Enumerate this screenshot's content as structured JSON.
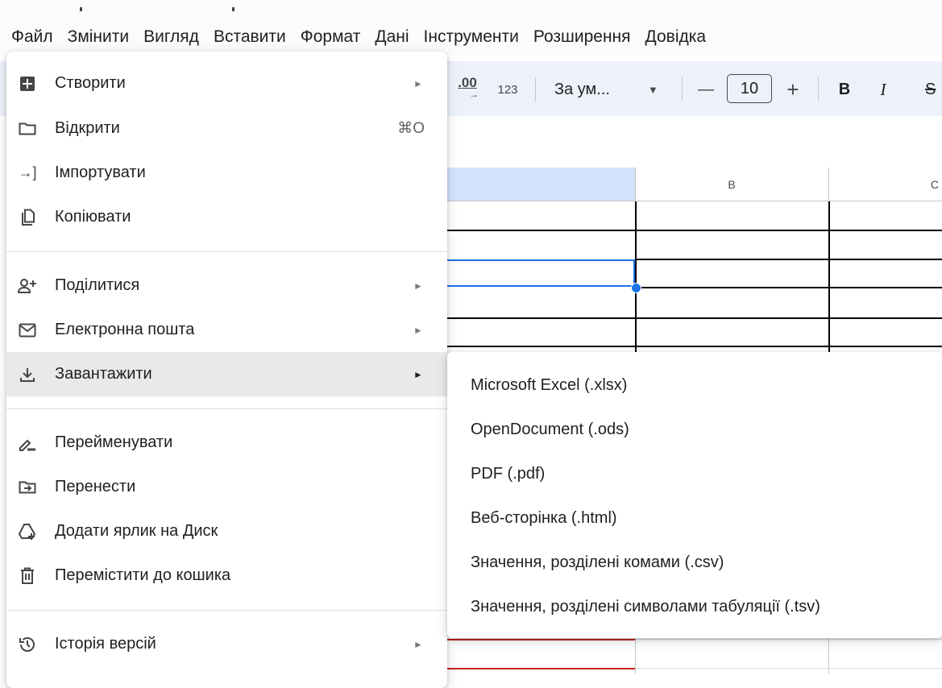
{
  "menubar": {
    "items": [
      "Файл",
      "Змінити",
      "Вигляд",
      "Вставити",
      "Формат",
      "Дані",
      "Інструменти",
      "Розширення",
      "Довідка"
    ]
  },
  "toolbar": {
    "decimal_label": ".00",
    "number_format_label": "123",
    "font_name": "За ум...",
    "font_size": "10",
    "minus": "—",
    "plus": "+",
    "bold": "B",
    "italic": "I",
    "strike": "S"
  },
  "grid": {
    "columns": [
      "B",
      "C"
    ]
  },
  "file_menu": {
    "groups": [
      [
        {
          "label": "Створити",
          "icon": "create-icon",
          "submenu": true
        },
        {
          "label": "Відкрити",
          "icon": "folder-icon",
          "shortcut": "⌘O"
        },
        {
          "label": "Імпортувати",
          "icon": "import-icon"
        },
        {
          "label": "Копіювати",
          "icon": "copy-icon"
        }
      ],
      [
        {
          "label": "Поділитися",
          "icon": "share-person-icon",
          "submenu": true
        },
        {
          "label": "Електронна пошта",
          "icon": "mail-icon",
          "submenu": true
        },
        {
          "label": "Завантажити",
          "icon": "download-icon",
          "submenu": true,
          "active": true
        }
      ],
      [
        {
          "label": "Перейменувати",
          "icon": "rename-icon"
        },
        {
          "label": "Перенести",
          "icon": "move-icon"
        },
        {
          "label": "Додати ярлик на Диск",
          "icon": "drive-shortcut-icon"
        },
        {
          "label": "Перемістити до кошика",
          "icon": "trash-icon"
        }
      ],
      [
        {
          "label": "Історія версій",
          "icon": "history-icon",
          "submenu": true
        }
      ]
    ]
  },
  "download_submenu": {
    "items": [
      "Microsoft Excel (.xlsx)",
      "OpenDocument (.ods)",
      "PDF (.pdf)",
      "Веб-сторінка (.html)",
      "Значення, розділені комами (.csv)",
      "Значення, розділені символами табуляції (.tsv)"
    ]
  },
  "colors": {
    "accent": "#1a73e8",
    "toolbar_bg": "#edf2fa",
    "selected_column_bg": "#d3e3fd",
    "active_item_bg": "#e9e9e9",
    "red_line": "#c5221f"
  }
}
